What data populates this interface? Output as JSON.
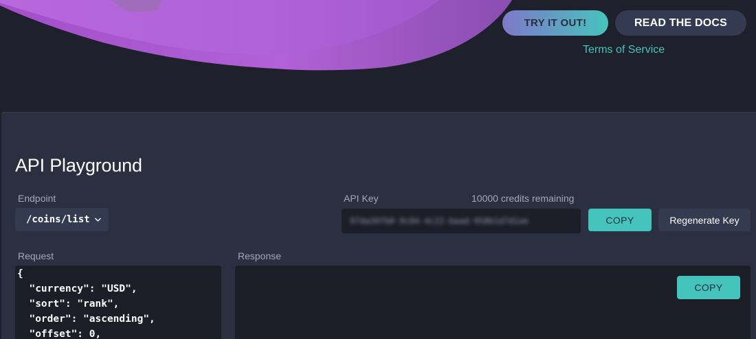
{
  "header": {
    "try_label": "TRY IT OUT!",
    "docs_label": "READ THE DOCS",
    "terms_label": "Terms of Service"
  },
  "playground": {
    "title": "API Playground",
    "endpoint": {
      "label": "Endpoint",
      "selected": "/coins/list"
    },
    "api_key": {
      "label": "API Key",
      "credits": "10000 credits remaining",
      "value_masked": "97da39fb0-9c84-4c22-baad-958b1d7d1ae",
      "copy_label": "COPY",
      "regenerate_label": "Regenerate Key"
    },
    "request": {
      "label": "Request",
      "lines": [
        "{",
        "  \"currency\": \"USD\",",
        "  \"sort\": \"rank\",",
        "  \"order\": \"ascending\",",
        "  \"offset\": 0,"
      ]
    },
    "response": {
      "label": "Response",
      "copy_label": "COPY"
    }
  },
  "colors": {
    "background": "#1e212b",
    "panel": "#2b3040",
    "accent": "#45c4bd",
    "field": "#1b1e27",
    "wave_purple": "#b05ad2"
  }
}
